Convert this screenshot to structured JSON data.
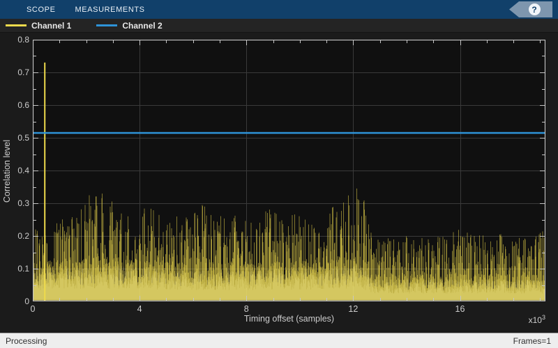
{
  "toolbar": {
    "tabs": [
      {
        "label": "SCOPE"
      },
      {
        "label": "MEASUREMENTS"
      }
    ],
    "help_label": "?"
  },
  "legend": {
    "items": [
      {
        "label": "Channel 1",
        "color": "#efdb4c"
      },
      {
        "label": "Channel 2",
        "color": "#2e93d8"
      }
    ]
  },
  "status_bar": {
    "left": "Processing",
    "right": "Frames=1"
  },
  "chart_data": {
    "type": "line",
    "title": "",
    "xlabel": "Timing offset (samples)",
    "ylabel": "Correlation level",
    "x_multiplier_base": "x10",
    "x_multiplier_exp": "3",
    "xlim": [
      0,
      19.2
    ],
    "ylim": [
      0,
      0.8
    ],
    "x_major_ticks": [
      0,
      4,
      8,
      12,
      16
    ],
    "x_tick_labels": [
      "0",
      "4",
      "8",
      "12",
      "16"
    ],
    "x_minor_step": 1,
    "y_major_ticks": [
      0,
      0.1,
      0.2,
      0.3,
      0.4,
      0.5,
      0.6,
      0.7,
      0.8
    ],
    "y_tick_labels": [
      "0",
      "0.1",
      "0.2",
      "0.3",
      "0.4",
      "0.5",
      "0.6",
      "0.7",
      "0.8"
    ],
    "y_minor_step": 0.05,
    "grid": true,
    "colors": {
      "plot_bg": "#101010",
      "figure_bg": "#1b1b1b",
      "grid": "#3a3a3a",
      "axis": "#c6c6c6",
      "noise_highlight": "rgba(252,243,160,0.5)"
    },
    "noise_seed": 20,
    "series": [
      {
        "name": "Channel 1",
        "color": "#efdb4c",
        "kind": "noisy",
        "peak": {
          "x": 0.45,
          "value": 0.73
        },
        "envelope": [
          [
            0,
            0.23
          ],
          [
            0.4,
            0.23
          ],
          [
            0.8,
            0.25
          ],
          [
            1.2,
            0.26
          ],
          [
            1.6,
            0.28
          ],
          [
            2.0,
            0.32
          ],
          [
            2.4,
            0.34
          ],
          [
            2.8,
            0.34
          ],
          [
            3.1,
            0.3
          ],
          [
            3.4,
            0.27
          ],
          [
            3.8,
            0.26
          ],
          [
            4.2,
            0.29
          ],
          [
            4.6,
            0.28
          ],
          [
            5.0,
            0.27
          ],
          [
            5.4,
            0.26
          ],
          [
            5.8,
            0.28
          ],
          [
            6.2,
            0.29
          ],
          [
            6.5,
            0.31
          ],
          [
            6.8,
            0.27
          ],
          [
            7.2,
            0.27
          ],
          [
            7.6,
            0.28
          ],
          [
            8.0,
            0.26
          ],
          [
            8.4,
            0.27
          ],
          [
            8.8,
            0.29
          ],
          [
            9.2,
            0.27
          ],
          [
            9.6,
            0.27
          ],
          [
            10.0,
            0.28
          ],
          [
            10.4,
            0.25
          ],
          [
            10.8,
            0.26
          ],
          [
            11.2,
            0.29
          ],
          [
            11.6,
            0.32
          ],
          [
            12.0,
            0.35
          ],
          [
            12.3,
            0.34
          ],
          [
            12.5,
            0.3
          ],
          [
            12.7,
            0.21
          ],
          [
            13.0,
            0.19
          ],
          [
            13.5,
            0.2
          ],
          [
            14.0,
            0.21
          ],
          [
            14.5,
            0.2
          ],
          [
            15.0,
            0.2
          ],
          [
            15.5,
            0.2
          ],
          [
            16.0,
            0.23
          ],
          [
            16.5,
            0.21
          ],
          [
            17.0,
            0.2
          ],
          [
            17.5,
            0.21
          ],
          [
            18.0,
            0.21
          ],
          [
            18.5,
            0.2
          ],
          [
            19.2,
            0.22
          ]
        ],
        "base_level": [
          [
            0,
            0.12
          ],
          [
            2.4,
            0.14
          ],
          [
            6.0,
            0.12
          ],
          [
            11.5,
            0.13
          ],
          [
            12.2,
            0.15
          ],
          [
            12.5,
            0.12
          ],
          [
            12.8,
            0.085
          ],
          [
            19.2,
            0.085
          ]
        ]
      },
      {
        "name": "Channel 2",
        "color": "#2e93d8",
        "kind": "constant",
        "value": 0.515
      }
    ]
  }
}
